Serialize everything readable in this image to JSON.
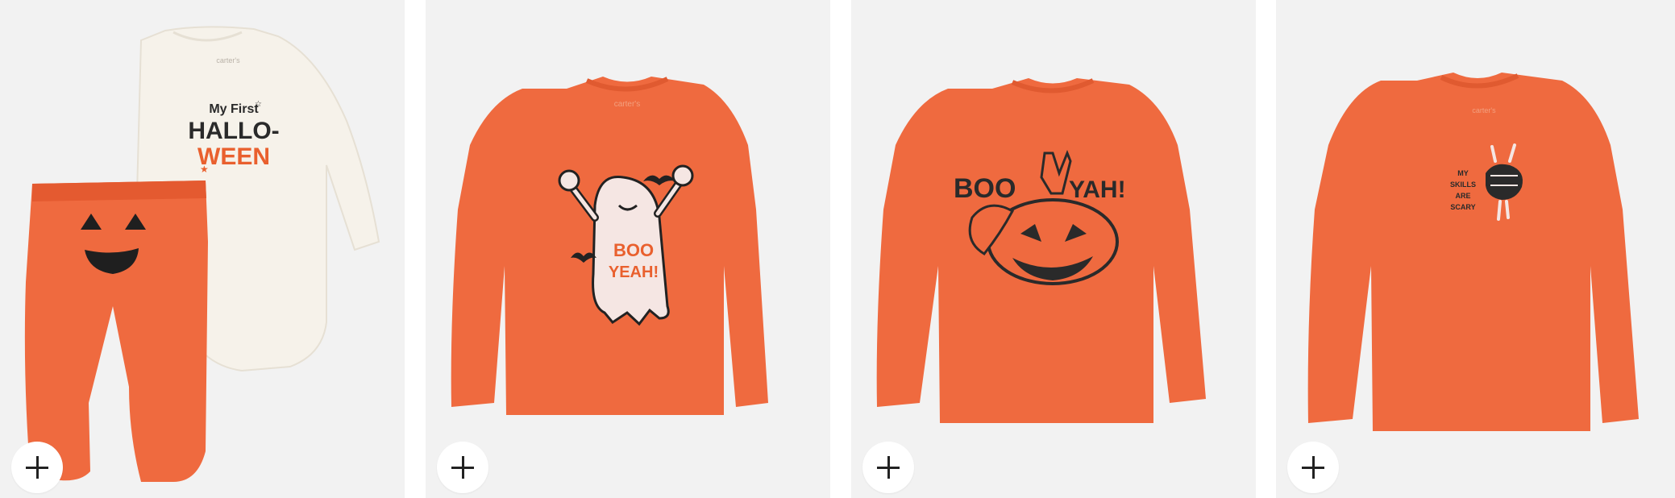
{
  "colors": {
    "card_background": "#f2f2f2",
    "shirt_orange": "#ef6a3f",
    "bodysuit_cream": "#f6f2ea",
    "print_dark": "#2a2a2a",
    "print_orange": "#e9602e"
  },
  "products": [
    {
      "brand_tag": "carter's",
      "print_lines": [
        "My First",
        "HALLO-",
        "WEEN"
      ],
      "add_icon": "plus-icon"
    },
    {
      "brand_tag": "carter's",
      "print_lines": [
        "BOO",
        "YEAH!"
      ],
      "add_icon": "plus-icon"
    },
    {
      "brand_tag": "carter's",
      "print_lines": [
        "BOO",
        "YAH!"
      ],
      "add_icon": "plus-icon"
    },
    {
      "brand_tag": "carter's",
      "print_lines": [
        "MY",
        "SKILLS",
        "ARE",
        "SCARY"
      ],
      "add_icon": "plus-icon"
    }
  ]
}
